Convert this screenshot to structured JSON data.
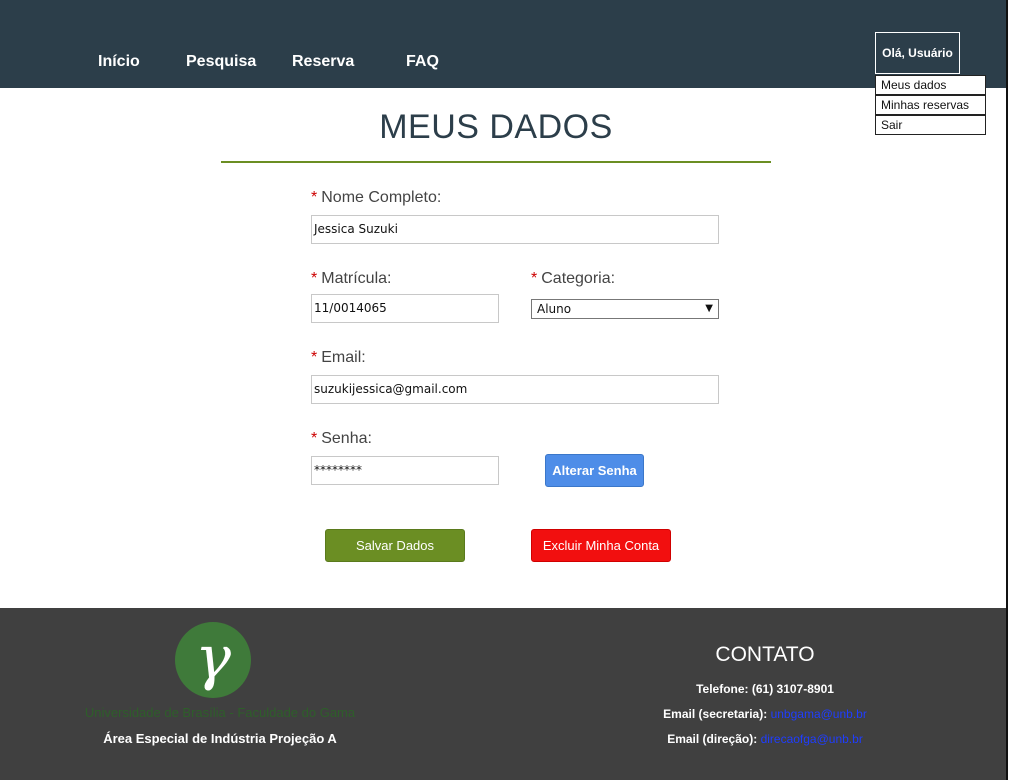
{
  "nav": {
    "items": [
      "Início",
      "Pesquisa",
      "Reserva",
      "FAQ"
    ]
  },
  "user_menu": {
    "greeting": "Olá, Usuário",
    "items": [
      "Meus dados",
      "Minhas reservas",
      "Sair"
    ]
  },
  "page": {
    "title": "MEUS DADOS"
  },
  "form": {
    "required_mark": "*",
    "full_name": {
      "label": "Nome Completo:",
      "value": "Jessica Suzuki"
    },
    "registration": {
      "label": "Matrícula:",
      "value": "11/0014065"
    },
    "category": {
      "label": "Categoria:",
      "value": "Aluno"
    },
    "email": {
      "label": "Email:",
      "value": "suzukijessica@gmail.com"
    },
    "password": {
      "label": "Senha:",
      "value": "********"
    },
    "change_password_label": "Alterar Senha",
    "save_label": "Salvar Dados",
    "delete_label": "Excluir Minha Conta"
  },
  "footer": {
    "university": "Universidade de Brasília - Faculdade do Gama",
    "address": "Área Especial de Indústria Projeção A",
    "logo_symbol": "γ",
    "contact_title": "CONTATO",
    "phone": "Telefone: (61) 3107-8901",
    "email_secretary_label": "Email (secretaria):",
    "email_secretary": "unbgama@unb.br",
    "email_direction_label": "Email (direção):",
    "email_direction": "direcaofga@unb.br"
  },
  "colors": {
    "header_bg": "#2c3e4a",
    "accent_green": "#6b8e23",
    "button_blue": "#4e8de8",
    "button_red": "#f20f0f",
    "footer_bg": "#404040"
  }
}
